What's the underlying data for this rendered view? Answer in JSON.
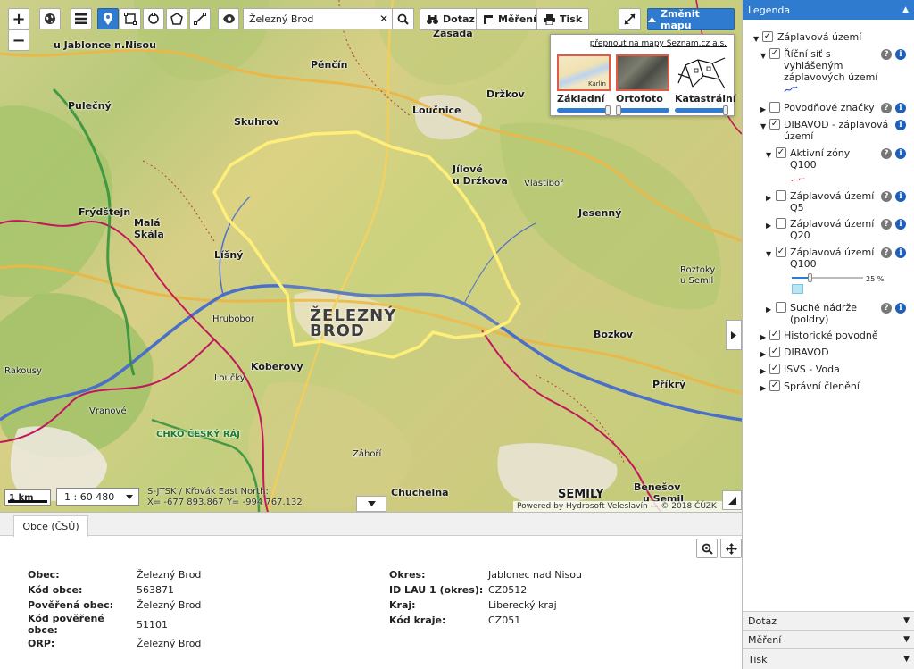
{
  "toolbar": {
    "zoom_in": "+",
    "zoom_out": "−",
    "search_value": "Železný Brod",
    "search_clear": "✕",
    "dotaz_label": "Dotaz",
    "mereni_label": "Měření",
    "tisk_label": "Tisk",
    "change_map_label": "Změnit mapu"
  },
  "basemaps": {
    "seznam_link": "přepnout na mapy Seznam.cz a.s.",
    "thumb_text": "Karlín",
    "items": [
      {
        "label": "Základní",
        "opacity": 1.0
      },
      {
        "label": "Ortofoto",
        "opacity": 0.0
      },
      {
        "label": "Katastrální",
        "opacity": 1.0
      }
    ]
  },
  "map": {
    "scale_label": "1 km",
    "ratio": "1 : 60 480",
    "coords_system": "S-JTSK / Křovák East North:",
    "coords_value": "X= -677 893.867  Y= -994 767.132",
    "attribution": "Powered by Hydrosoft Veleslavín — © 2018 ČÚZK",
    "labels": {
      "jablonec": "u Jablonce n.Nisou",
      "zasada": "Zásada",
      "pencin": "Pěnčín",
      "drzkov": "Držkov",
      "pulecny": "Pulečný",
      "skuhrov": "Skuhrov",
      "loucnice": "Loučnice",
      "jilove": "Jílové",
      "jilove2": "u Držkova",
      "frydstejn": "Frýdštejn",
      "mala_skala": "Malá",
      "mala_skala2": "Skála",
      "jesenny": "Jesenný",
      "lisny": "Líšný",
      "zelezny_brod_1": "ŽELEZNÝ",
      "zelezny_brod_2": "BROD",
      "bozkov": "Bozkov",
      "koberovy": "Koberovy",
      "prikry": "Příkrý",
      "chuchelna": "Chuchelna",
      "semily": "SEMILY",
      "benesov": "Benešov",
      "benesov2": "u Semil",
      "cesky_raj": "CHKO ČESKÝ RÁJ",
      "roztoky": "Roztoky",
      "roztoky2": "u Semil",
      "vlastibor": "Vlastiboř",
      "rakousy": "Rakousy",
      "zahori": "Záhoří",
      "loucky": "Loučky",
      "hrubobor": "Hrubobor",
      "turnov": "Vranové"
    }
  },
  "bottom": {
    "tab_label": "Obce (ČSÚ)",
    "left_rows": [
      {
        "key": "Obec:",
        "value": "Železný Brod"
      },
      {
        "key": "Kód obce:",
        "value": "563871"
      },
      {
        "key": "Pověřená obec:",
        "value": "Železný Brod"
      },
      {
        "key": "Kód pověřené obce:",
        "value": "51101"
      },
      {
        "key": "ORP:",
        "value": "Železný Brod"
      }
    ],
    "right_rows": [
      {
        "key": "Okres:",
        "value": "Jablonec nad Nisou"
      },
      {
        "key": "ID LAU 1 (okres):",
        "value": "CZ0512"
      },
      {
        "key": "Kraj:",
        "value": "Liberecký kraj"
      },
      {
        "key": "Kód kraje:",
        "value": "CZ051"
      }
    ]
  },
  "legend": {
    "header": "Legenda",
    "items": [
      {
        "label": "Záplavová území"
      },
      {
        "label": "Říční síť s vyhlášeným záplavových území",
        "line1": "Říční síť s",
        "line2": "vyhlášeným",
        "line3": "záplavových území"
      },
      {
        "label": "Povodňové značky"
      },
      {
        "label": "DIBAVOD - záplavová území",
        "line1": "DIBAVOD - záplavová",
        "line2": "území"
      },
      {
        "label": "Aktivní zóny Q100",
        "line1": "Aktivní zóny",
        "line2": "Q100"
      },
      {
        "label": "Záplavová území Q5",
        "line1": "Záplavová území",
        "line2": "Q5"
      },
      {
        "label": "Záplavová území Q20",
        "line1": "Záplavová území",
        "line2": "Q20"
      },
      {
        "label": "Záplavová území Q100",
        "line1": "Záplavová území",
        "line2": "Q100"
      },
      {
        "label": "Suché nádrže (poldry)",
        "line1": "Suché nádrže",
        "line2": "(poldry)"
      },
      {
        "label": "Historické povodně"
      },
      {
        "label": "DIBAVOD"
      },
      {
        "label": "ISVS - Voda"
      },
      {
        "label": "Správní členění"
      }
    ],
    "opacity_label": "25 %",
    "opacity_value": 0.25,
    "accordions": [
      "Dotaz",
      "Měření",
      "Tisk"
    ]
  },
  "colors": {
    "accent": "#2e7bd0",
    "boundary_yellow": "#ffef7a",
    "boundary_magenta": "#c2185b",
    "forest_green": "#2f8f3a",
    "river": "#4a6fc9"
  }
}
